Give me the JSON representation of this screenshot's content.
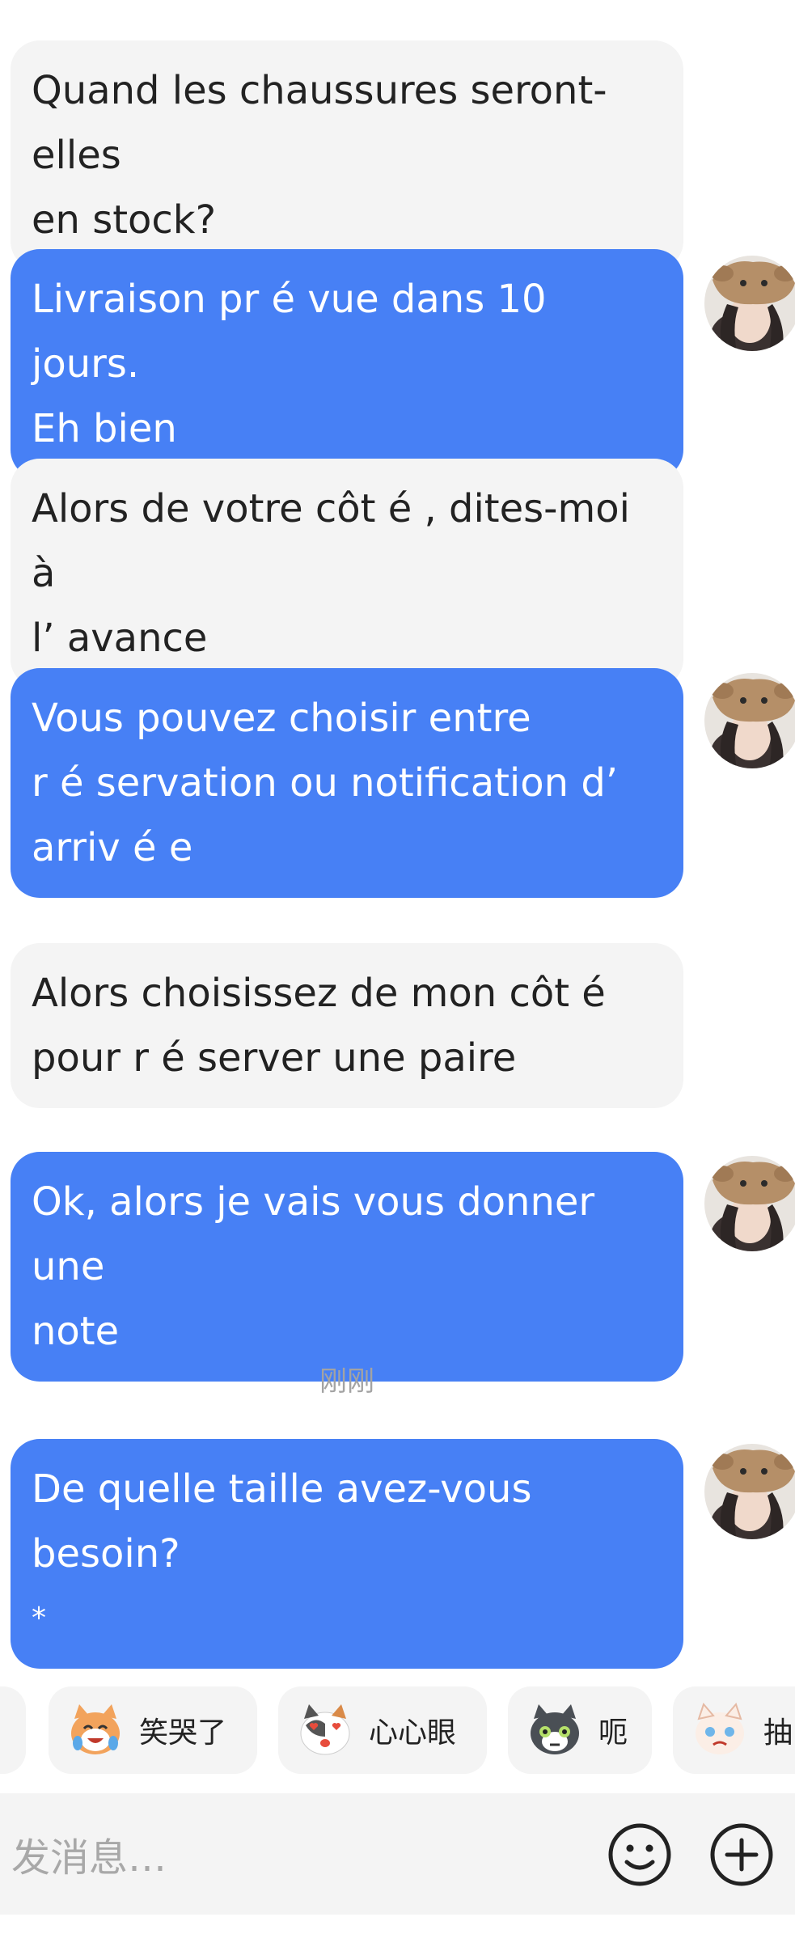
{
  "messages": [
    {
      "lines": [
        "Quand les chaussures seront-elles",
        "en stock?"
      ]
    },
    {
      "lines": [
        "Livraison pr é vue dans 10 jours.",
        "Eh bien"
      ]
    },
    {
      "lines": [
        "Alors de votre côt é , dites-moi  à",
        "l’  avance"
      ]
    },
    {
      "lines": [
        "Vous pouvez choisir entre",
        "r é servation ou notification d’",
        "arriv é e"
      ]
    },
    {
      "lines": [
        "Alors choisissez de mon côt é",
        "pour r é server une paire"
      ]
    },
    {
      "lines": [
        "Ok, alors je vais vous donner une",
        "note"
      ]
    },
    {
      "lines": [
        "De quelle taille avez-vous besoin?",
        "*"
      ]
    }
  ],
  "timestamp": "刚刚",
  "quick_reactions": [
    {
      "label": "笑哭了",
      "icon": "laugh-cry-cat-icon"
    },
    {
      "label": "心心眼",
      "icon": "heart-eyes-cat-icon"
    },
    {
      "label": "呃",
      "icon": "awkward-cat-icon"
    },
    {
      "label": "抽",
      "icon": "sob-cat-icon"
    }
  ],
  "input": {
    "placeholder": "发消息…"
  },
  "colors": {
    "outgoing_bubble": "#4780f5",
    "incoming_bubble": "#f4f4f4",
    "timestamp_text": "#a3a3a3",
    "placeholder_text": "#a8a8a8"
  }
}
